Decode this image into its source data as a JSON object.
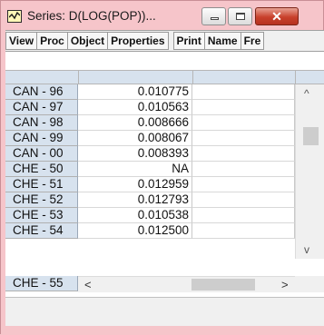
{
  "window": {
    "title": "Series: D(LOG(POP))...",
    "close_glyph": "✕",
    "icon": "series-icon"
  },
  "toolbar": {
    "buttons": [
      "View",
      "Proc",
      "Object",
      "Properties",
      "Print",
      "Name",
      "Fre"
    ]
  },
  "spreadsheet": {
    "rows": [
      {
        "label": "CAN - 96",
        "value": "0.010775"
      },
      {
        "label": "CAN - 97",
        "value": "0.010563"
      },
      {
        "label": "CAN - 98",
        "value": "0.008666"
      },
      {
        "label": "CAN - 99",
        "value": "0.008067"
      },
      {
        "label": "CAN - 00",
        "value": "0.008393"
      },
      {
        "label": "CHE - 50",
        "value": "NA"
      },
      {
        "label": "CHE - 51",
        "value": "0.012959"
      },
      {
        "label": "CHE - 52",
        "value": "0.012793"
      },
      {
        "label": "CHE - 53",
        "value": "0.010538"
      },
      {
        "label": "CHE - 54",
        "value": "0.012500"
      }
    ],
    "last_row_label": "CHE - 55"
  },
  "scrollbars": {
    "up_arrow": "^",
    "down_arrow": "v",
    "left_arrow": "<",
    "right_arrow": ">"
  }
}
